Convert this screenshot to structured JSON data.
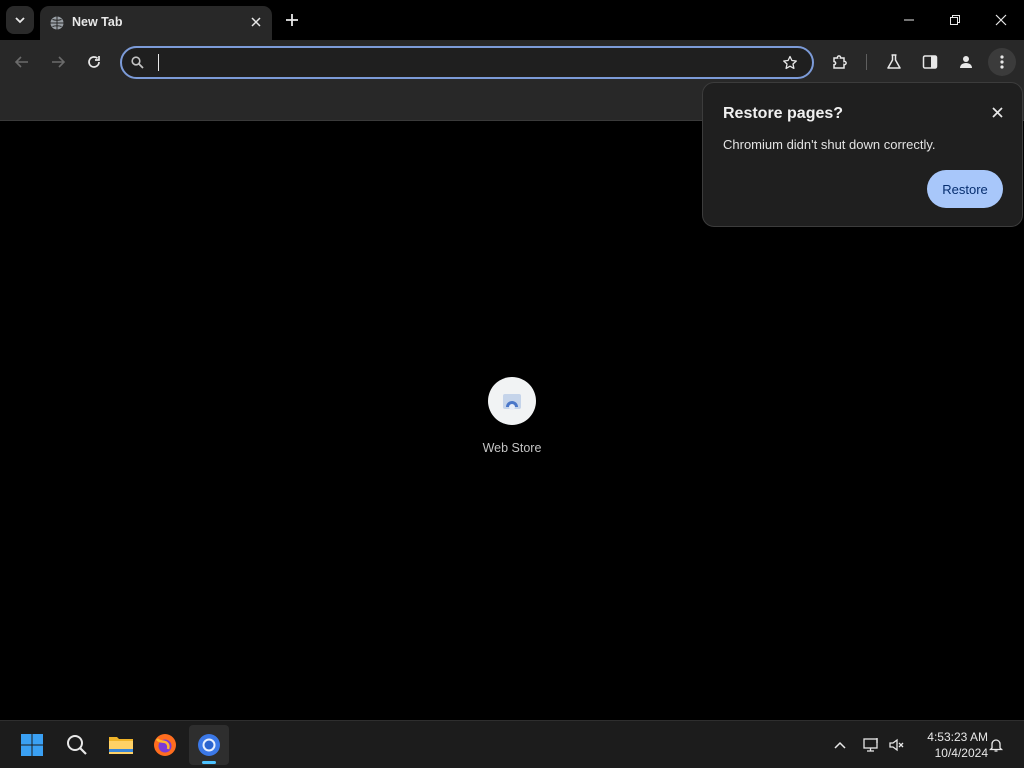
{
  "tabs": [
    {
      "title": "New Tab",
      "active": true
    }
  ],
  "omnibox": {
    "value": "",
    "placeholder": ""
  },
  "popup": {
    "title": "Restore pages?",
    "message": "Chromium didn't shut down correctly.",
    "button_label": "Restore"
  },
  "shortcuts": [
    {
      "label": "Web Store",
      "icon": "web-store-icon"
    }
  ],
  "taskbar": {
    "apps": [
      "start-icon",
      "search-icon",
      "file-explorer-icon",
      "firefox-icon",
      "chromium-icon"
    ],
    "time": "4:53:23 AM",
    "date": "10/4/2024"
  },
  "colors": {
    "accent": "#a8c7fa",
    "omnibox_focus": "#7c9bd8",
    "toolbar_bg": "#282828",
    "taskbar_indicator": "#4cc2ff"
  }
}
